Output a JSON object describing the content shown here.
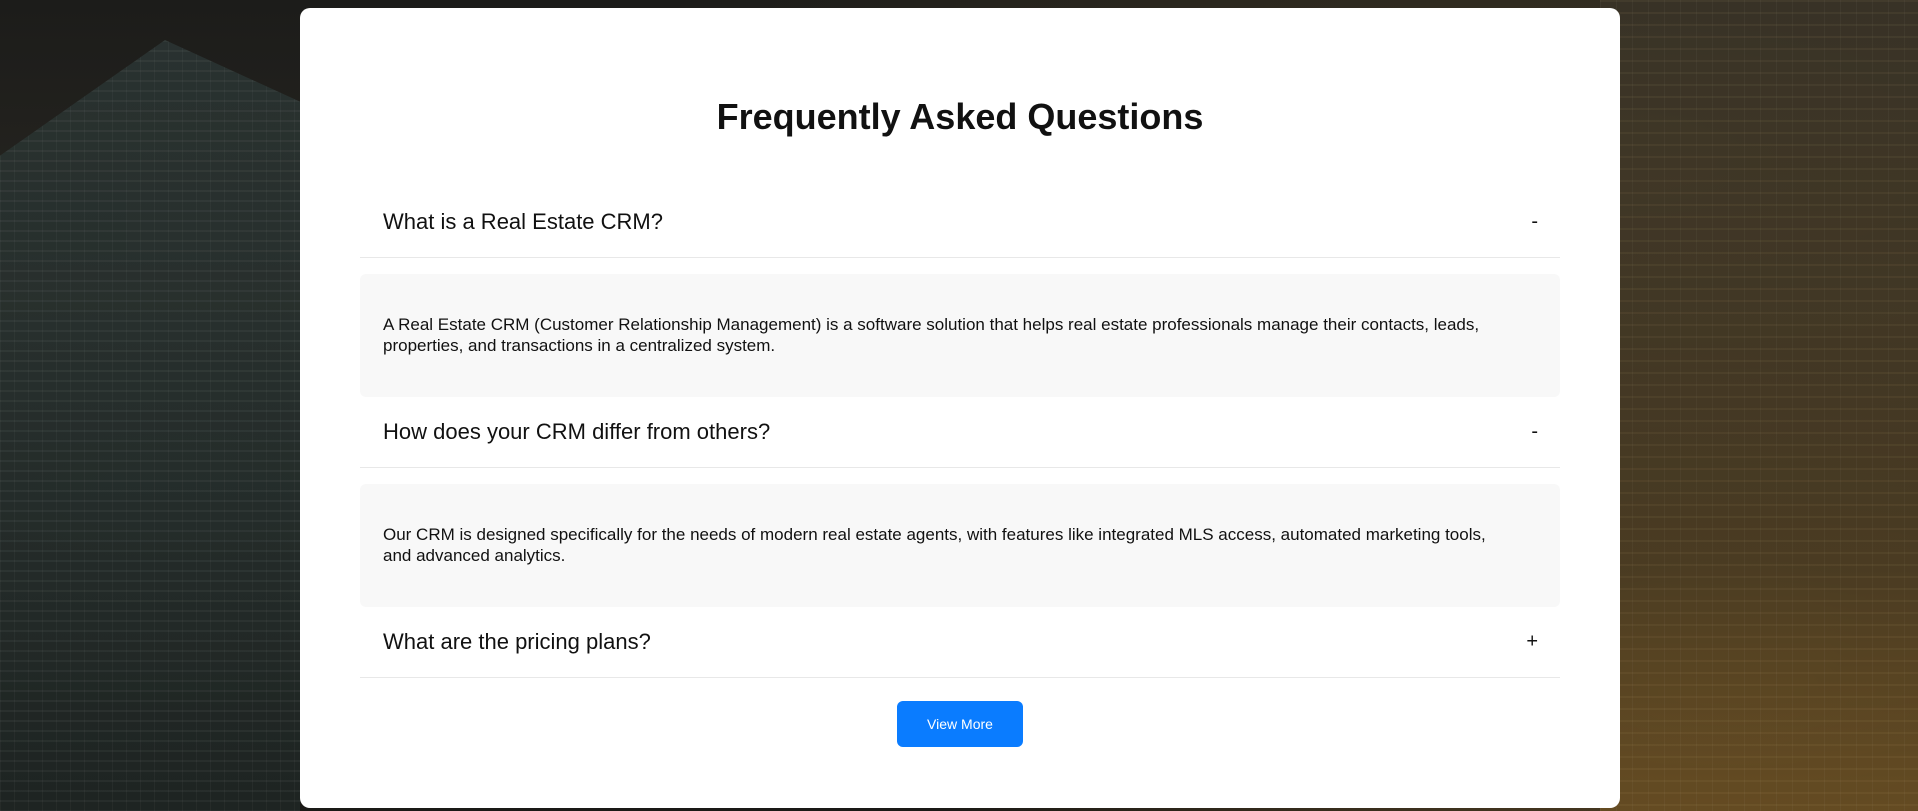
{
  "faq": {
    "title": "Frequently Asked Questions",
    "items": [
      {
        "question": "What is a Real Estate CRM?",
        "toggle": "-",
        "expanded": true,
        "answer": "A Real Estate CRM (Customer Relationship Management) is a software solution that helps real estate professionals manage their contacts, leads, properties, and transactions in a centralized system."
      },
      {
        "question": "How does your CRM differ from others?",
        "toggle": "-",
        "expanded": true,
        "answer": "Our CRM is designed specifically for the needs of modern real estate agents, with features like integrated MLS access, automated marketing tools, and advanced analytics."
      },
      {
        "question": "What are the pricing plans?",
        "toggle": "+",
        "expanded": false
      }
    ],
    "view_more_label": "View More"
  },
  "colors": {
    "accent": "#0a7cff",
    "card_background": "#ffffff",
    "answer_background": "#f8f8f8"
  }
}
